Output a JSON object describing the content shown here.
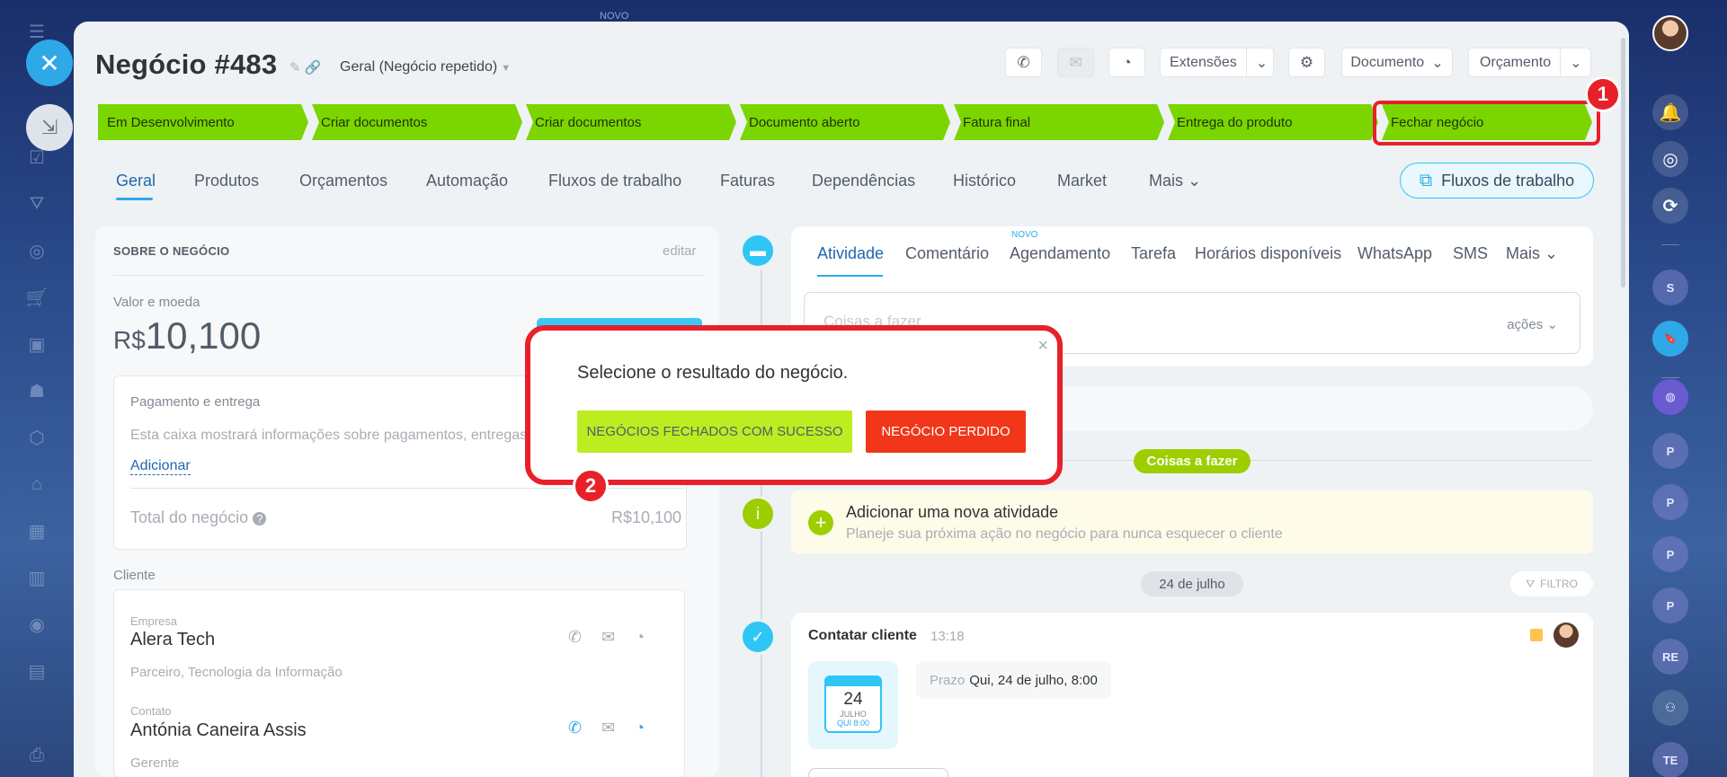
{
  "window": {
    "novo_top_label": "NOVO"
  },
  "header": {
    "title": "Negócio #483",
    "pipeline": "Geral (Negócio repetido)",
    "extensions_label": "Extensões",
    "document_label": "Documento",
    "quote_label": "Orçamento"
  },
  "stages": [
    {
      "label": "Em Desenvolvimento"
    },
    {
      "label": "Criar documentos"
    },
    {
      "label": "Criar documentos"
    },
    {
      "label": "Documento aberto"
    },
    {
      "label": "Fatura final"
    },
    {
      "label": "Entrega do produto"
    },
    {
      "label": "Fechar negócio"
    }
  ],
  "annotations": {
    "badge_1": "1",
    "badge_2": "2"
  },
  "tabs": [
    {
      "label": "Geral",
      "active": true
    },
    {
      "label": "Produtos"
    },
    {
      "label": "Orçamentos"
    },
    {
      "label": "Automação"
    },
    {
      "label": "Fluxos de trabalho"
    },
    {
      "label": "Faturas"
    },
    {
      "label": "Dependências"
    },
    {
      "label": "Histórico"
    },
    {
      "label": "Market"
    },
    {
      "label": "Mais"
    }
  ],
  "workflow_button": "Fluxos de trabalho",
  "about": {
    "title": "SOBRE O NEGÓCIO",
    "edit": "editar",
    "value_label": "Valor e moeda",
    "currency": "R$",
    "amount": "10,100",
    "payment_label": "Pagamento e entrega",
    "payment_text": "Esta caixa mostrará informações sobre pagamentos, entregas",
    "add_link": "Adicionar",
    "total_label": "Total do negócio",
    "total_value": "R$10,100",
    "client_label": "Cliente",
    "company_label": "Empresa",
    "company_name": "Alera Tech",
    "company_desc": "Parceiro, Tecnologia da Informação",
    "contact_label": "Contato",
    "contact_name": "Antónia Caneira Assis",
    "contact_role": "Gerente"
  },
  "activity": {
    "tabs": [
      {
        "label": "Atividade",
        "active": true
      },
      {
        "label": "Comentário"
      },
      {
        "label": "Agendamento",
        "badge": "NOVO"
      },
      {
        "label": "Tarefa"
      },
      {
        "label": "Horários disponíveis"
      },
      {
        "label": "WhatsApp"
      },
      {
        "label": "SMS"
      },
      {
        "label": "Mais"
      }
    ],
    "input_placeholder": "Coisas a fazer",
    "actions_label": "ações"
  },
  "timeline": {
    "todo_pill": "Coisas a fazer",
    "new_activity_title": "Adicionar uma nova atividade",
    "new_activity_sub": "Planeje sua próxima ação no negócio para nunca esquecer o cliente",
    "date_pill": "24 de julho",
    "filter": "FILTRO",
    "task_title": "Contatar cliente",
    "task_time": "13:18",
    "cal_day": "24",
    "cal_month": "JULHO",
    "cal_weekday": "QUI 8:00",
    "deadline_label": "Prazo",
    "deadline_value": "Qui, 24 de julho, 8:00"
  },
  "modal": {
    "title": "Selecione o resultado do negócio.",
    "win_button": "NEGÓCIOS FECHADOS COM SUCESSO",
    "lose_button": "NEGÓCIO PERDIDO"
  },
  "right_rail": {
    "letters": [
      "S",
      "P",
      "P",
      "P",
      "P",
      "RE",
      "TE"
    ]
  },
  "colors": {
    "stage_green": "#7bd500",
    "accent_blue": "#2fa8e8",
    "highlight_red": "#e8202a",
    "win_green": "#bbed21",
    "lose_red": "#f1361a"
  }
}
